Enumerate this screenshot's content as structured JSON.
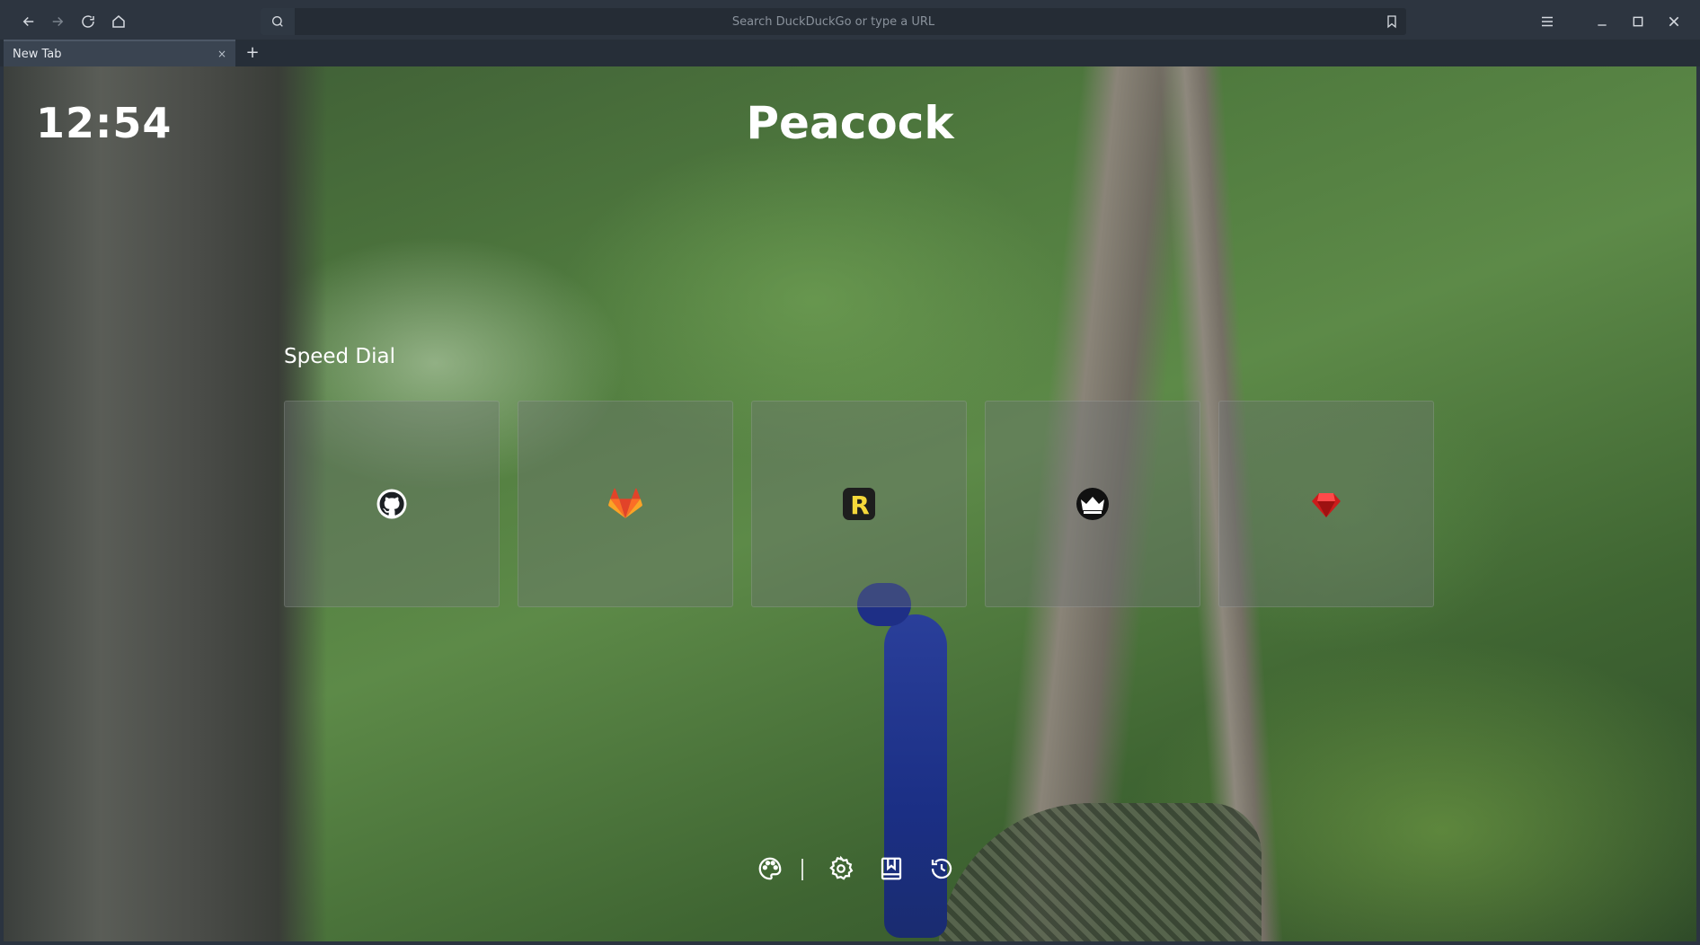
{
  "toolbar": {
    "back_icon": "arrow-left-icon",
    "forward_icon": "arrow-right-icon",
    "reload_icon": "reload-icon",
    "home_icon": "home-icon",
    "search_placeholder": "Search DuckDuckGo or type a URL",
    "search_value": ""
  },
  "tabs": [
    {
      "title": "New Tab",
      "close": "×"
    }
  ],
  "new_tab_label": "+",
  "page": {
    "clock": "12:54",
    "title": "Peacock",
    "speed_dial_title": "Speed Dial",
    "speed_dial": [
      {
        "icon": "github-icon",
        "color": "#ffffff"
      },
      {
        "icon": "gitlab-icon",
        "color": "#fc6d26"
      },
      {
        "icon": "r-icon",
        "color": "#f5d83a"
      },
      {
        "icon": "crown-icon",
        "color": "#ffffff"
      },
      {
        "icon": "ruby-icon",
        "color": "#cc1b1b"
      }
    ],
    "bottom_icons": [
      "palette-icon",
      "settings-icon",
      "bookmarks-icon",
      "history-icon"
    ]
  }
}
